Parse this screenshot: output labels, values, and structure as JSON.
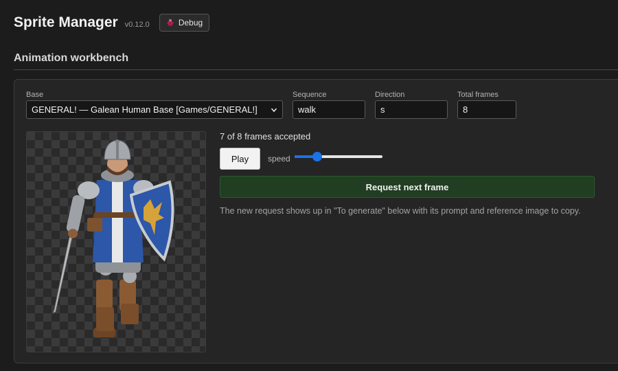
{
  "app": {
    "title": "Sprite Manager",
    "version": "v0.12.0",
    "debug_label": "Debug"
  },
  "section": {
    "title": "Animation workbench"
  },
  "form": {
    "base": {
      "label": "Base",
      "value": "GENERAL! — Galean Human Base [Games/GENERAL!]"
    },
    "sequence": {
      "label": "Sequence",
      "value": "walk"
    },
    "direction": {
      "label": "Direction",
      "value": "s"
    },
    "total_frames": {
      "label": "Total frames",
      "value": "8"
    }
  },
  "preview": {
    "frames_status": "7 of 8 frames accepted",
    "play_label": "Play",
    "speed_label": "speed",
    "speed_fraction": 0.26,
    "request_label": "Request next frame",
    "help_text": "The new request shows up in \"To generate\" below with its prompt and reference image to copy."
  },
  "colors": {
    "accent": "#1a73e8",
    "request_bg": "#213d22",
    "debug_icon": "#c2185b"
  },
  "icons": {
    "debug": "bug-icon",
    "select": "chevron-down-icon"
  }
}
